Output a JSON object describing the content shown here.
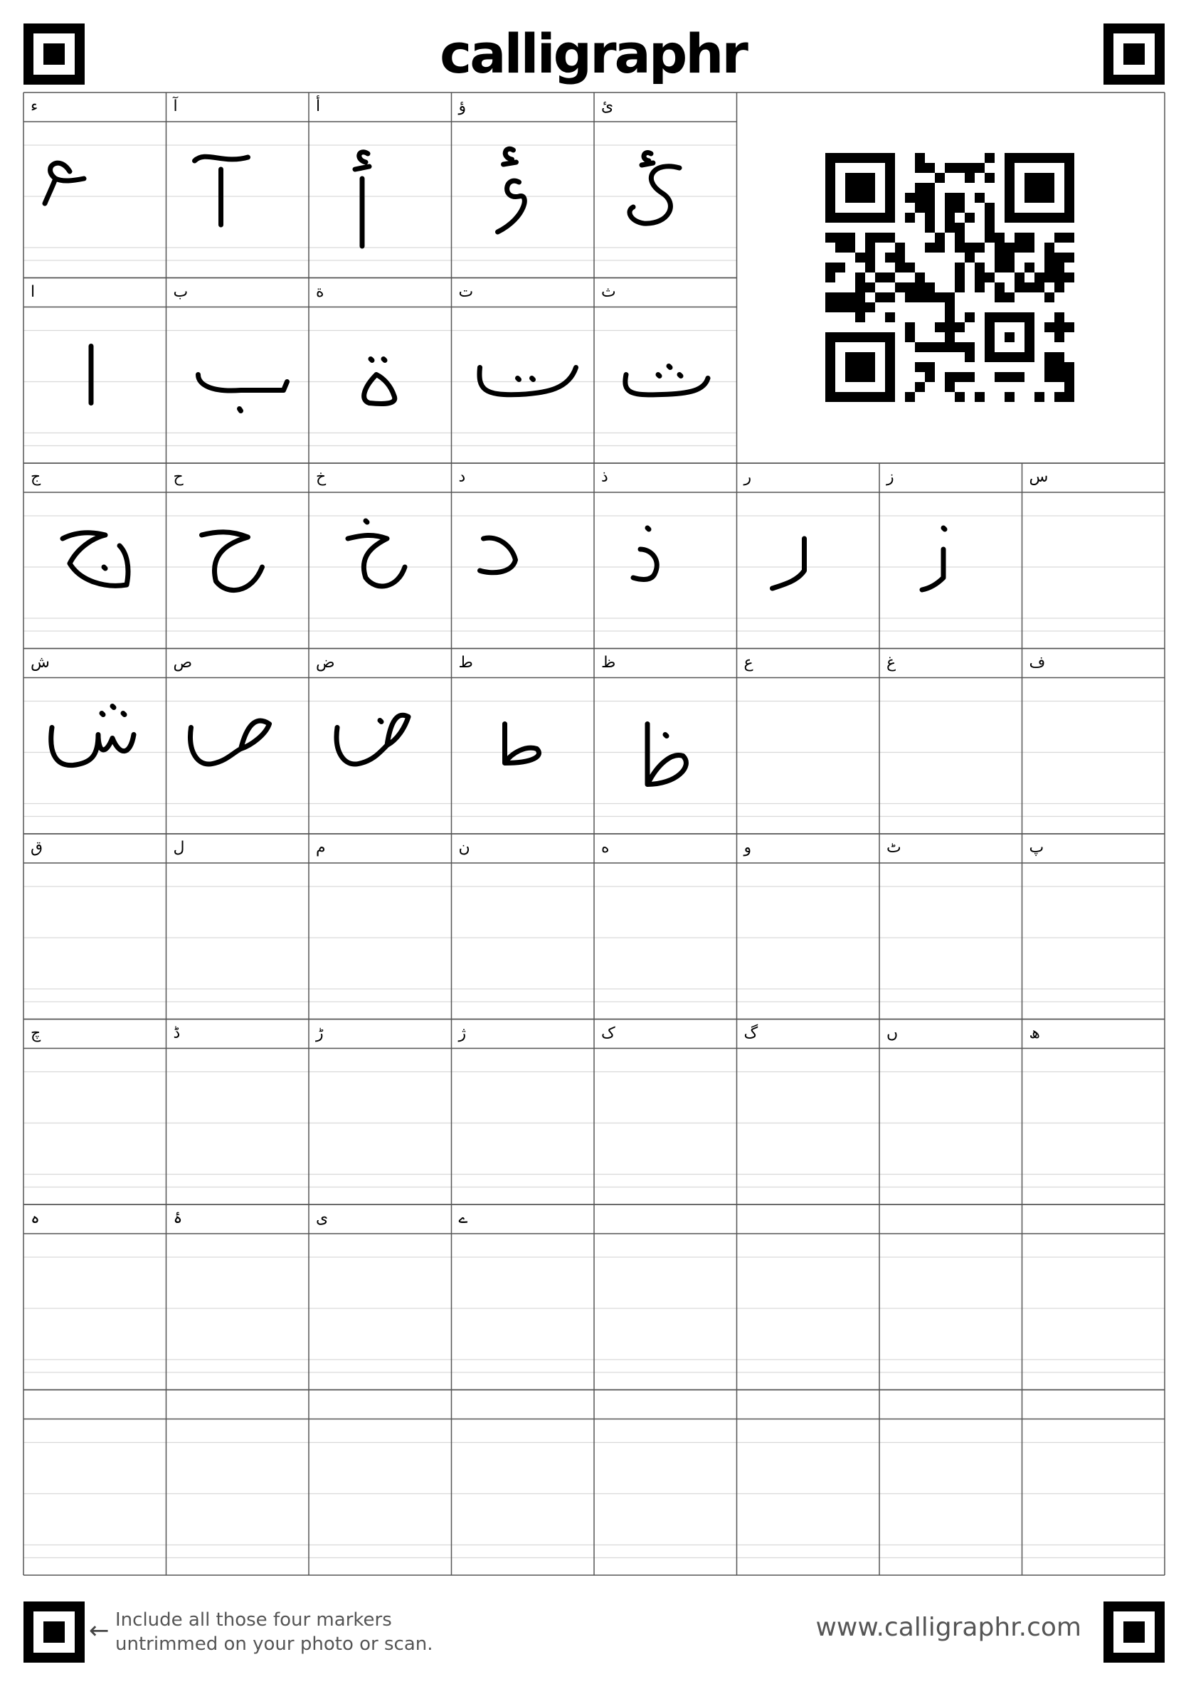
{
  "brand": {
    "logo_text": "calligraphr",
    "website": "www.calligraphr.com"
  },
  "instructions": {
    "line1": "Include all those four markers",
    "line2": "untrimmed on your photo or scan."
  },
  "rows": [
    {
      "cells": [
        {
          "char": "ء",
          "glyph": "hamza"
        },
        {
          "char": "آ",
          "glyph": "alef-madda"
        },
        {
          "char": "أ",
          "glyph": "alef-hamza"
        },
        {
          "char": "ؤ",
          "glyph": "waw-hamza"
        },
        {
          "char": "ئ",
          "glyph": "yeh-hamza"
        }
      ]
    },
    {
      "cells": [
        {
          "char": "ا",
          "glyph": "alef"
        },
        {
          "char": "ب",
          "glyph": "beh"
        },
        {
          "char": "ة",
          "glyph": "teh-marbuta"
        },
        {
          "char": "ت",
          "glyph": "teh"
        },
        {
          "char": "ث",
          "glyph": "theh"
        }
      ]
    },
    {
      "cells": [
        {
          "char": "ج",
          "glyph": "jeem"
        },
        {
          "char": "ح",
          "glyph": "hah"
        },
        {
          "char": "خ",
          "glyph": "khah"
        },
        {
          "char": "د",
          "glyph": "dal"
        },
        {
          "char": "ذ",
          "glyph": "thal"
        },
        {
          "char": "ر",
          "glyph": "reh"
        },
        {
          "char": "ز",
          "glyph": "zain"
        },
        {
          "char": "س",
          "glyph": ""
        }
      ]
    },
    {
      "cells": [
        {
          "char": "ش",
          "glyph": "sheen"
        },
        {
          "char": "ص",
          "glyph": "sad"
        },
        {
          "char": "ض",
          "glyph": "dad"
        },
        {
          "char": "ط",
          "glyph": "tah"
        },
        {
          "char": "ظ",
          "glyph": "zah"
        },
        {
          "char": "ع",
          "glyph": ""
        },
        {
          "char": "غ",
          "glyph": ""
        },
        {
          "char": "ف",
          "glyph": ""
        }
      ]
    },
    {
      "cells": [
        {
          "char": "ق",
          "glyph": ""
        },
        {
          "char": "ل",
          "glyph": ""
        },
        {
          "char": "م",
          "glyph": ""
        },
        {
          "char": "ن",
          "glyph": ""
        },
        {
          "char": "ه",
          "glyph": ""
        },
        {
          "char": "و",
          "glyph": ""
        },
        {
          "char": "ٹ",
          "glyph": ""
        },
        {
          "char": "پ",
          "glyph": ""
        }
      ]
    },
    {
      "cells": [
        {
          "char": "چ",
          "glyph": ""
        },
        {
          "char": "ڈ",
          "glyph": ""
        },
        {
          "char": "ڑ",
          "glyph": ""
        },
        {
          "char": "ژ",
          "glyph": ""
        },
        {
          "char": "ک",
          "glyph": ""
        },
        {
          "char": "گ",
          "glyph": ""
        },
        {
          "char": "ں",
          "glyph": ""
        },
        {
          "char": "ھ",
          "glyph": ""
        }
      ]
    },
    {
      "cells": [
        {
          "char": "ہ",
          "glyph": ""
        },
        {
          "char": "ۂ",
          "glyph": ""
        },
        {
          "char": "ی",
          "glyph": ""
        },
        {
          "char": "ے",
          "glyph": ""
        },
        {
          "char": "",
          "glyph": ""
        },
        {
          "char": "",
          "glyph": ""
        },
        {
          "char": "",
          "glyph": ""
        },
        {
          "char": "",
          "glyph": ""
        }
      ]
    },
    {
      "cells": [
        {
          "char": "",
          "glyph": ""
        },
        {
          "char": "",
          "glyph": ""
        },
        {
          "char": "",
          "glyph": ""
        },
        {
          "char": "",
          "glyph": ""
        },
        {
          "char": "",
          "glyph": ""
        },
        {
          "char": "",
          "glyph": ""
        },
        {
          "char": "",
          "glyph": ""
        },
        {
          "char": "",
          "glyph": ""
        }
      ]
    }
  ]
}
